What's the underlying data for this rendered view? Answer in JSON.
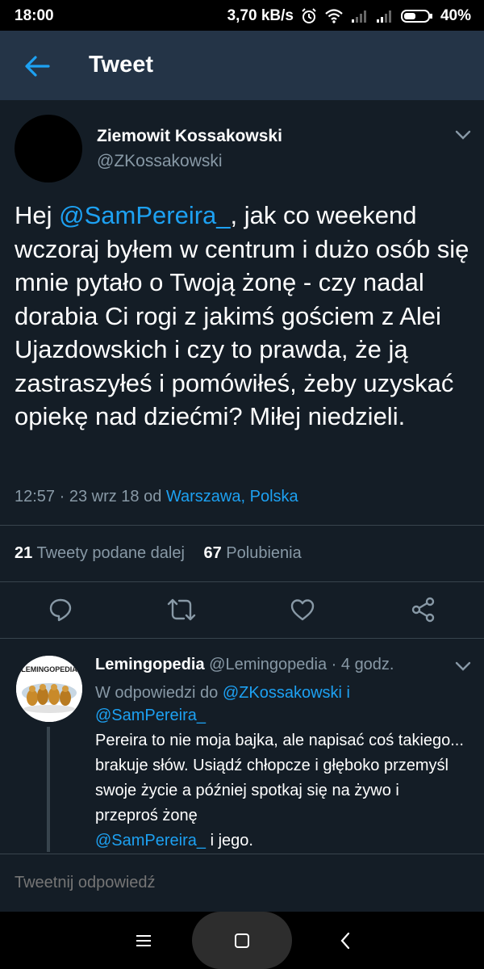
{
  "status_bar": {
    "time": "18:00",
    "network_speed": "3,70 kB/s",
    "battery": "40%",
    "icons": [
      "alarm-icon",
      "wifi-icon",
      "signal-icon",
      "signal-icon",
      "battery-icon"
    ]
  },
  "app_bar": {
    "title": "Tweet",
    "back_icon": "arrow-left-icon"
  },
  "tweet": {
    "author_name": "Ziemowit Kossakowski",
    "author_handle": "@ZKossakowski",
    "text_before_mention": "Hej ",
    "mention": "@SamPereira_",
    "text_after_mention": ", jak co weekend wczoraj byłem w centrum i dużo osób się mnie pytało o Twoją żonę - czy nadal dorabia Ci rogi z jakimś gościem z Alei Ujazdowskich i czy to prawda, że ją zastraszyłeś i pomówiłeś, żeby uzyskać opiekę nad dziećmi? Miłej niedzieli.",
    "meta_time": "12:57 · 23 wrz 18 od ",
    "meta_location": "Warszawa, Polska",
    "retweets_count": "21",
    "retweets_label": "Tweety podane dalej",
    "likes_count": "67",
    "likes_label": "Polubienia",
    "actions": [
      "reply-icon",
      "retweet-icon",
      "like-icon",
      "share-icon"
    ]
  },
  "reply": {
    "name": "Lemingopedia",
    "handle": "@Lemingopedia",
    "time": " · 4 godz.",
    "avatar_text": "LEMINGOPEDIA",
    "replying_prefix": "W odpowiedzi do ",
    "replying_user1": "@ZKossakowski i",
    "replying_user2": "@SamPereira_",
    "text": "Pereira to nie moja bajka, ale napisać coś takiego... brakuje słów. Usiądź chłopcze i głęboko przemyśl swoje życie a później spotkaj się na żywo i przeproś żonę",
    "text_mention": "@SamPereira_",
    "text_end": "  i jego."
  },
  "compose": {
    "placeholder": "Tweetnij odpowiedź"
  },
  "nav_bar": {
    "icons": [
      "menu-icon",
      "home-icon",
      "back-icon"
    ]
  },
  "colors": {
    "background": "#141d26",
    "app_bar": "#243447",
    "accent": "#1da1f2",
    "muted": "#8899a6",
    "divider": "#38444d"
  }
}
